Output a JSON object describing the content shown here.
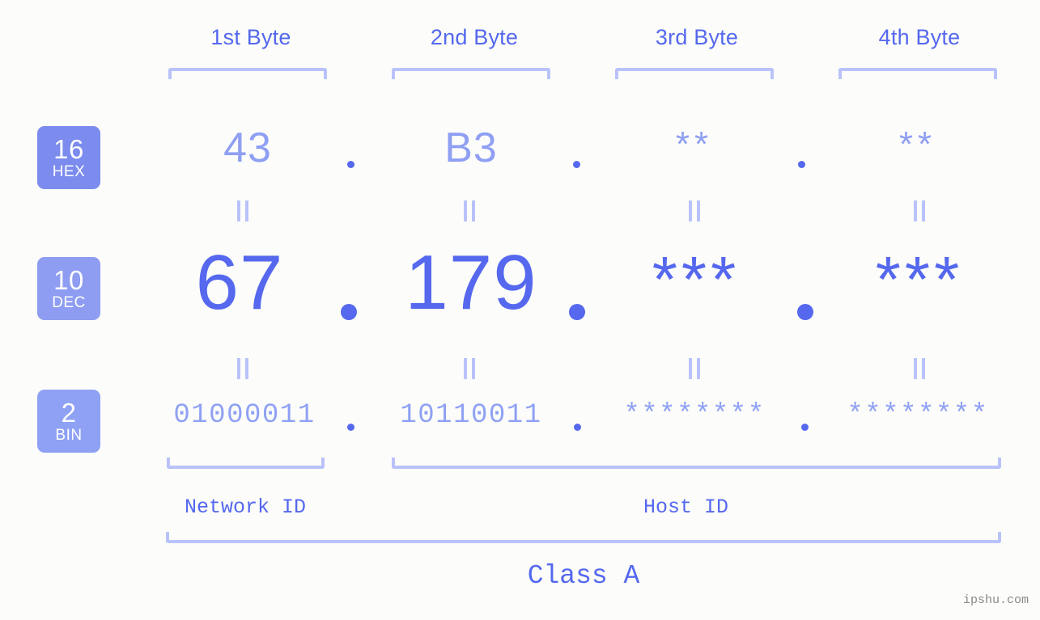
{
  "watermark": "ipshu.com",
  "headers": [
    {
      "label": "1st Byte"
    },
    {
      "label": "2nd Byte"
    },
    {
      "label": "3rd Byte"
    },
    {
      "label": "4th Byte"
    }
  ],
  "bases": [
    {
      "num": "16",
      "abbr": "HEX"
    },
    {
      "num": "10",
      "abbr": "DEC"
    },
    {
      "num": "2",
      "abbr": "BIN"
    }
  ],
  "rows": {
    "hex": {
      "values": [
        "43",
        "B3",
        "**",
        "**"
      ]
    },
    "dec": {
      "values": [
        "67",
        "179",
        "***",
        "***"
      ]
    },
    "bin": {
      "values": [
        "01000011",
        "10110011",
        "********",
        "********"
      ]
    }
  },
  "separators": {
    "dot": "."
  },
  "equals": {
    "symbol": "="
  },
  "footer": {
    "network_id": "Network ID",
    "host_id": "Host ID",
    "class": "Class A"
  },
  "colors": {
    "background": "#fcfdfa",
    "accent_strong": "#5568ee",
    "accent_mid": "#8f9ff3",
    "accent_light": "#b9c2fa",
    "badge": "#7b8bee"
  }
}
